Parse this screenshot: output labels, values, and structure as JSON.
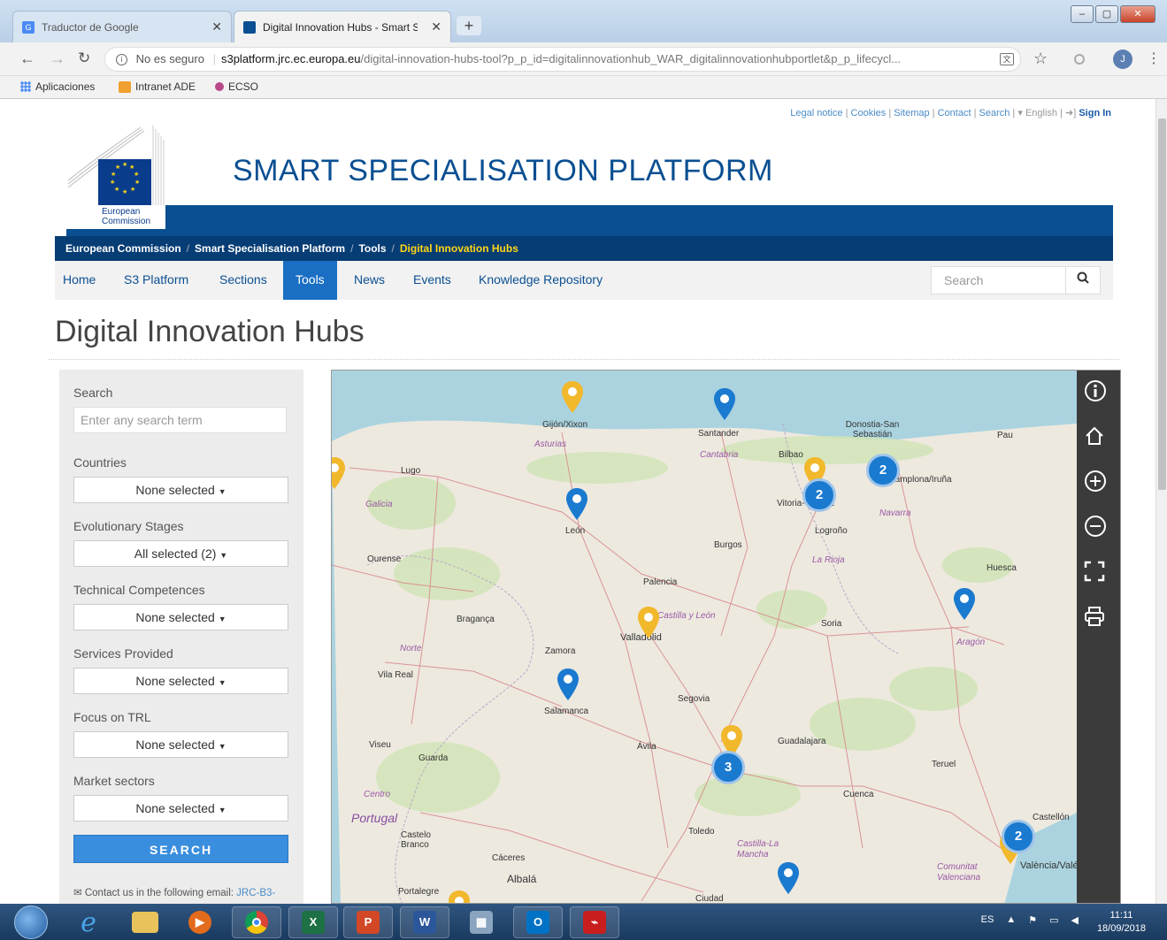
{
  "browser": {
    "tabs": [
      {
        "title": "Traductor de Google",
        "active": false
      },
      {
        "title": "Digital Innovation Hubs - Smart S",
        "active": true
      }
    ],
    "security_label": "No es seguro",
    "url_host": "s3platform.jrc.ec.europa.eu",
    "url_path": "/digital-innovation-hubs-tool?p_p_id=digitalinnovationhub_WAR_digitalinnovationhubportlet&p_p_lifecycl...",
    "profile_initial": "J",
    "bookmarks": [
      {
        "label": "Aplicaciones",
        "icon": "apps-grid-icon"
      },
      {
        "label": "Intranet ADE",
        "icon": "folder-icon"
      },
      {
        "label": "ECSO",
        "icon": "ecso-icon"
      }
    ]
  },
  "top_links": [
    "Legal notice",
    "Cookies",
    "Sitemap",
    "Contact",
    "Search"
  ],
  "language": "English",
  "sign_in": "Sign In",
  "logo_text": [
    "European",
    "Commission"
  ],
  "site_title": "SMART SPECIALISATION PLATFORM",
  "breadcrumb": [
    "European Commission",
    "Smart Specialisation Platform",
    "Tools",
    "Digital Innovation Hubs"
  ],
  "nav": [
    {
      "label": "Home",
      "active": false
    },
    {
      "label": "S3 Platform",
      "active": false
    },
    {
      "label": "Sections",
      "active": false
    },
    {
      "label": "Tools",
      "active": true
    },
    {
      "label": "News",
      "active": false
    },
    {
      "label": "Events",
      "active": false
    },
    {
      "label": "Knowledge Repository",
      "active": false
    }
  ],
  "nav_search_placeholder": "Search",
  "page_title": "Digital Innovation Hubs",
  "filters": {
    "search_label": "Search",
    "search_placeholder": "Enter any search term",
    "groups": [
      {
        "label": "Countries",
        "value": "None selected"
      },
      {
        "label": "Evolutionary Stages",
        "value": "All selected (2)"
      },
      {
        "label": "Technical Competences",
        "value": "None selected"
      },
      {
        "label": "Services Provided",
        "value": "None selected"
      },
      {
        "label": "Focus on TRL",
        "value": "None selected"
      },
      {
        "label": "Market sectors",
        "value": "None selected"
      }
    ],
    "search_button": "SEARCH",
    "contact_text": "Contact us in the following email:",
    "contact_email": "JRC-B3-"
  },
  "map": {
    "controls": [
      "info-icon",
      "home-icon",
      "zoom-in-icon",
      "zoom-out-icon",
      "fullscreen-icon",
      "print-icon"
    ],
    "labels": {
      "cities": [
        "Gijón/Xixon",
        "Santander",
        "Donostia-San Sebastián",
        "Bilbao",
        "Lugo",
        "León",
        "Vitoria-Gasteiz",
        "Logroño",
        "Burgos",
        "Ourense",
        "Palencia",
        "Huesca",
        "Bragança",
        "Valladolid",
        "Soria",
        "Zamora",
        "Vila Real",
        "Segovia",
        "Salamanca",
        "Guadalajara",
        "Ávila",
        "Viseu",
        "Guarda",
        "Teruel",
        "Cuenca",
        "Castelo Branco",
        "Toledo",
        "Cáceres",
        "Albalá",
        "Portalegre",
        "Ciudad",
        "Castellón",
        "València/Valé",
        "Pau",
        "Pamplona/Iruña"
      ],
      "regions": [
        "Asturias",
        "Cantabria",
        "Galicia",
        "Navarra",
        "La Rioja",
        "Castilla y León",
        "Norte",
        "Aragón",
        "Centro",
        "Castilla-La Mancha",
        "Comunitat Valenciana"
      ],
      "country": "Portugal"
    },
    "clusters": [
      "2",
      "2",
      "3",
      "2"
    ]
  },
  "taskbar": {
    "apps": [
      "windows-start-icon",
      "internet-explorer-icon",
      "file-explorer-icon",
      "media-player-icon",
      "chrome-icon",
      "excel-icon",
      "powerpoint-icon",
      "word-icon",
      "calculator-icon",
      "outlook-icon",
      "acrobat-icon"
    ],
    "lang": "ES",
    "time": "11:11",
    "date": "18/09/2018"
  },
  "colors": {
    "eu_blue": "#0a4f92",
    "nav_active": "#1a6fc4",
    "pin_blue": "#1a7ad0",
    "pin_yellow": "#f2b82c"
  }
}
